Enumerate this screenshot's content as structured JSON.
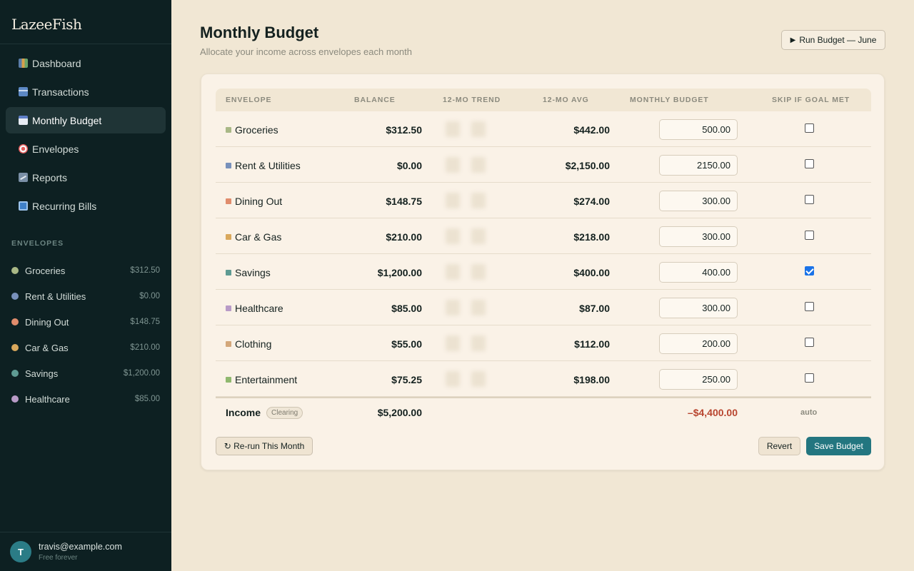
{
  "sidebar": {
    "brand": "LazeeFish",
    "nav": [
      {
        "label": "Dashboard",
        "icon": "chart-icon"
      },
      {
        "label": "Transactions",
        "icon": "card-icon"
      },
      {
        "label": "Monthly Budget",
        "icon": "calendar-icon",
        "active": true
      },
      {
        "label": "Envelopes",
        "icon": "target-icon"
      },
      {
        "label": "Reports",
        "icon": "trend-chart-icon"
      },
      {
        "label": "Recurring Bills",
        "icon": "repeat-icon"
      }
    ],
    "envelopes_heading": "ENVELOPES",
    "envelopes": [
      {
        "name": "Groceries",
        "balance": "$312.50",
        "color": "#a9b886"
      },
      {
        "name": "Rent & Utilities",
        "balance": "$0.00",
        "color": "#7891bb"
      },
      {
        "name": "Dining Out",
        "balance": "$148.75",
        "color": "#e08c6c"
      },
      {
        "name": "Car & Gas",
        "balance": "$210.00",
        "color": "#d9a85c"
      },
      {
        "name": "Savings",
        "balance": "$1,200.00",
        "color": "#5e9b93"
      },
      {
        "name": "Healthcare",
        "balance": "$85.00",
        "color": "#b89bc7"
      }
    ],
    "account": {
      "initial": "T",
      "email": "travis@example.com",
      "plan": "Free forever"
    }
  },
  "header": {
    "title": "Monthly Budget",
    "subtitle": "Allocate your income across envelopes each month",
    "run_button": "Run Budget — June"
  },
  "table": {
    "headers": {
      "envelope": "ENVELOPE",
      "balance": "BALANCE",
      "trend": "12-MO TREND",
      "avg": "12-MO AVG",
      "budget": "MONTHLY BUDGET",
      "skip": "SKIP IF GOAL MET"
    },
    "rows": [
      {
        "name": "Groceries",
        "color": "#a9b886",
        "balance": "$312.50",
        "avg": "$442.00",
        "budget": "500.00",
        "skip": false
      },
      {
        "name": "Rent & Utilities",
        "color": "#7891bb",
        "balance": "$0.00",
        "avg": "$2,150.00",
        "budget": "2150.00",
        "skip": false
      },
      {
        "name": "Dining Out",
        "color": "#e08c6c",
        "balance": "$148.75",
        "avg": "$274.00",
        "budget": "300.00",
        "skip": false
      },
      {
        "name": "Car & Gas",
        "color": "#d9a85c",
        "balance": "$210.00",
        "avg": "$218.00",
        "budget": "300.00",
        "skip": false
      },
      {
        "name": "Savings",
        "color": "#5e9b93",
        "balance": "$1,200.00",
        "avg": "$400.00",
        "budget": "400.00",
        "skip": true
      },
      {
        "name": "Healthcare",
        "color": "#b89bc7",
        "balance": "$85.00",
        "avg": "$87.00",
        "budget": "300.00",
        "skip": false
      },
      {
        "name": "Clothing",
        "color": "#d3a77a",
        "balance": "$55.00",
        "avg": "$112.00",
        "budget": "200.00",
        "skip": false
      },
      {
        "name": "Entertainment",
        "color": "#8fb86e",
        "balance": "$75.25",
        "avg": "$198.00",
        "budget": "250.00",
        "skip": false
      }
    ],
    "total": {
      "label": "Income",
      "badge": "Clearing",
      "balance": "$5,200.00",
      "difference": "–$4,400.00",
      "skip_text": "auto"
    }
  },
  "footer": {
    "rerun": "↻ Re-run This Month",
    "revert": "Revert",
    "save": "Save Budget"
  },
  "colors": {
    "accent": "#237680",
    "negative": "#b8452f",
    "sidebar_bg": "#0d2022",
    "page_bg": "#f1e7d4"
  }
}
